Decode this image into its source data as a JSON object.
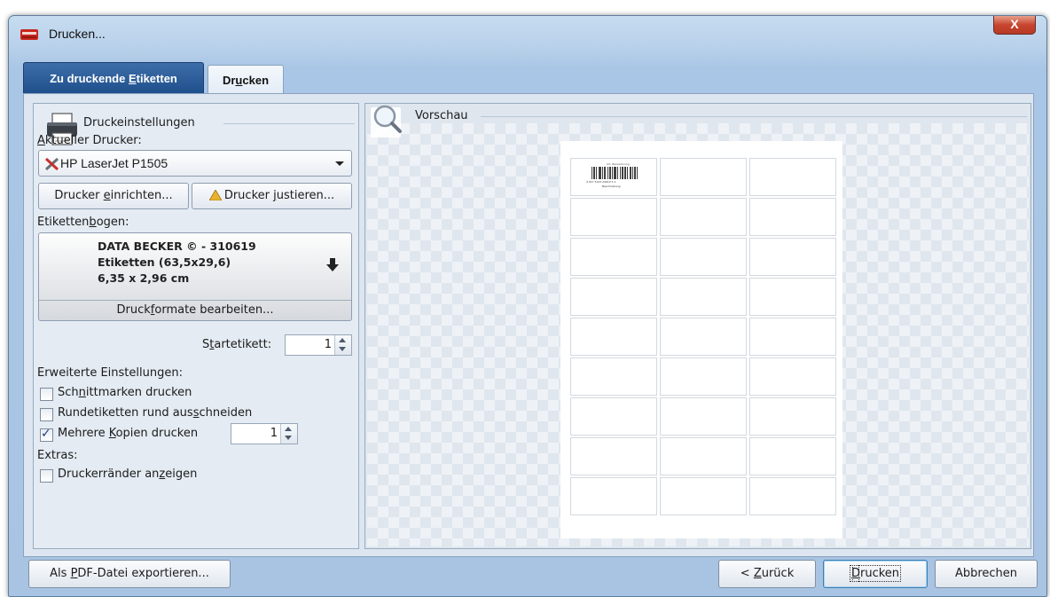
{
  "window": {
    "title": "Drucken...",
    "close_label": "X"
  },
  "tabs": [
    {
      "pre": "Zu druckende ",
      "key": "E",
      "post": "tiketten"
    },
    {
      "pre": "Dr",
      "key": "u",
      "post": "cken"
    }
  ],
  "settings": {
    "group_label": "Druckeinstellungen",
    "current_printer_label": {
      "pre": "",
      "key": "A",
      "post": "ktueller Drucker:"
    },
    "printer_value": "HP LaserJet P1505",
    "setup_button": {
      "pre": "Drucker ",
      "key": "e",
      "post": "inrichten..."
    },
    "adjust_button": {
      "pre": "Drucker ",
      "key": "j",
      "post": "ustieren..."
    },
    "sheet_label": {
      "pre": "Etiketten",
      "key": "b",
      "post": "ogen:"
    },
    "sheet_lines": [
      "DATA BECKER © - 310619",
      "Etiketten (63,5x29,6)",
      "6,35 x 2,96 cm"
    ],
    "edit_formats": {
      "pre": "Druck",
      "key": "f",
      "post": "ormate bearbeiten..."
    },
    "start_label": {
      "pre": "S",
      "key": "t",
      "post": "artetikett:"
    },
    "start_value": "1",
    "advanced_label": "Erweiterte Einstellungen:",
    "options": [
      {
        "pre": "Sch",
        "key": "n",
        "post": "ittmarken drucken",
        "checked": false
      },
      {
        "pre": "Rundetiketten rund aus",
        "key": "s",
        "post": "chneiden",
        "checked": false
      },
      {
        "pre": "Mehrere ",
        "key": "K",
        "post": "opien drucken",
        "checked": true
      }
    ],
    "copies_value": "1",
    "extras_label": "Extras:",
    "extras": [
      {
        "pre": "Druckerränder an",
        "key": "z",
        "post": "eigen",
        "checked": false
      }
    ]
  },
  "preview": {
    "label": "Vorschau",
    "first_label": {
      "top_text": "Art. Bezeichnung",
      "number": "4 017 5123 24010 5 1",
      "desc": "Beschreibung"
    }
  },
  "footer": {
    "export_button": {
      "pre": "Als ",
      "key": "P",
      "post": "DF-Datei exportieren..."
    },
    "back_button": {
      "pre": "< ",
      "key": "Z",
      "post": "urück"
    },
    "print_button": {
      "pre": "",
      "key": "D",
      "post": "rucken"
    },
    "cancel_button": "Abbrechen"
  }
}
